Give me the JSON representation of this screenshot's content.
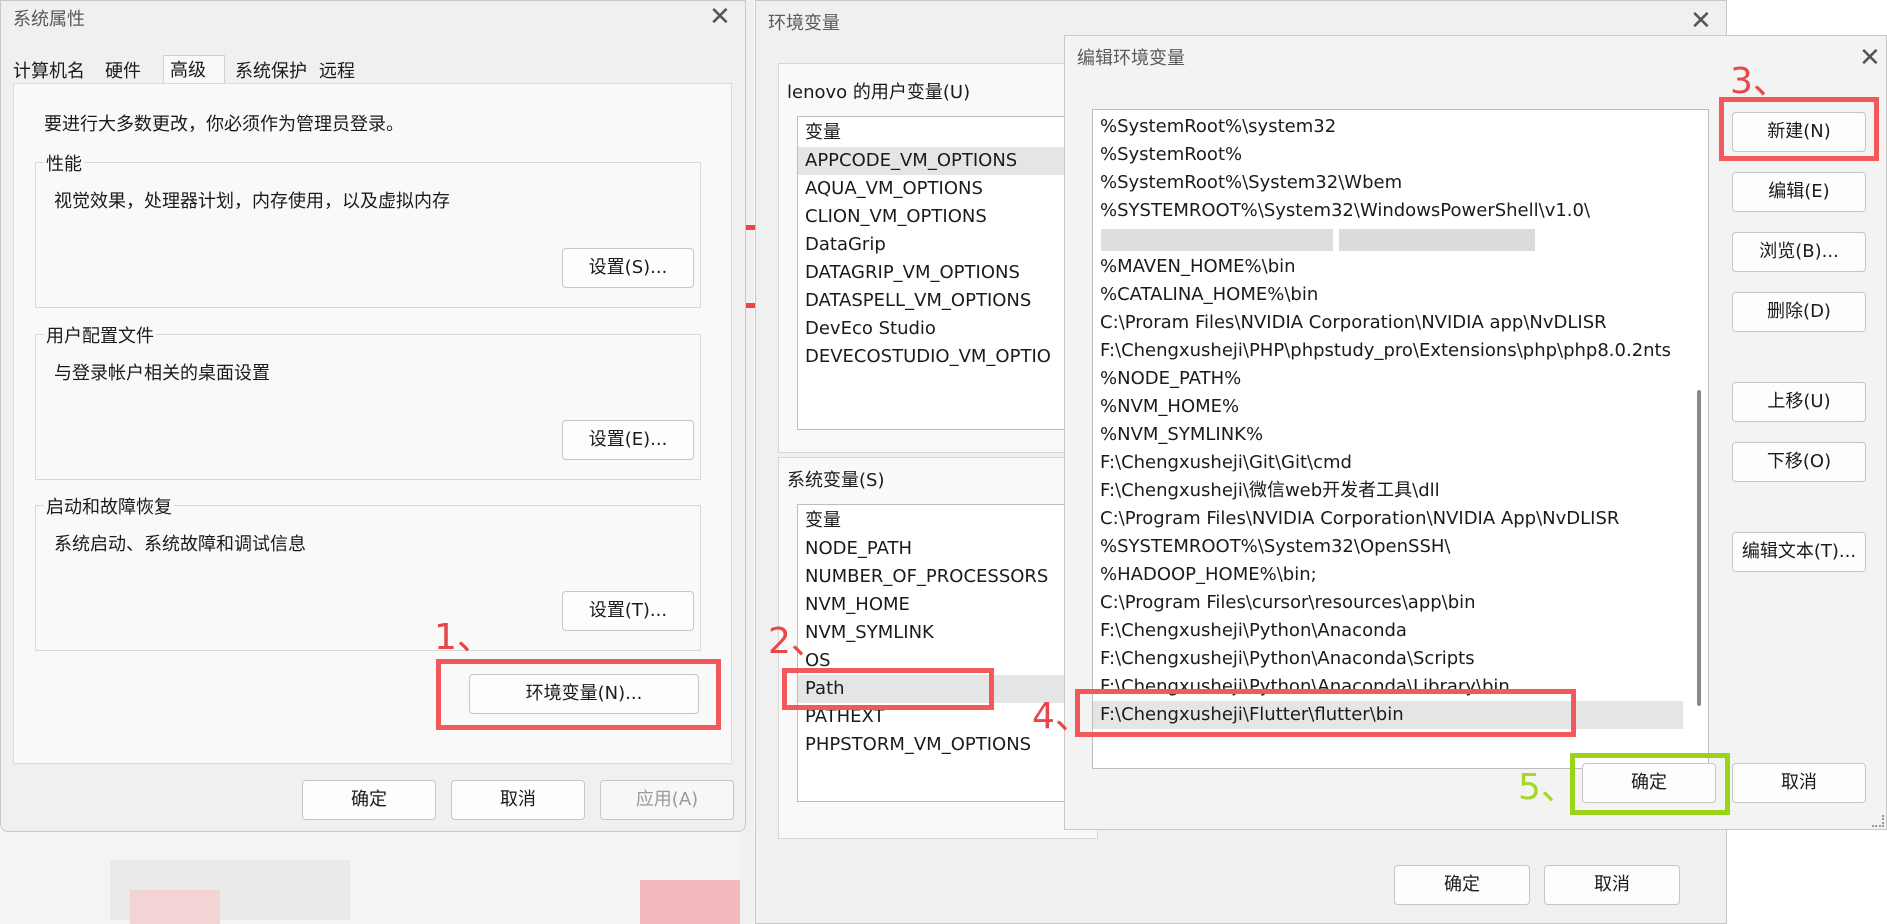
{
  "colors": {
    "red_highlight": "#f2595b",
    "green_highlight": "#9ad317",
    "step_red": "#e8474a",
    "step_green": "#a6d62c"
  },
  "sys_props": {
    "title": "系统属性",
    "tabs": [
      "计算机名",
      "硬件",
      "高级",
      "系统保护",
      "远程"
    ],
    "admin_note": "要进行大多数更改，你必须作为管理员登录。",
    "performance": {
      "label": "性能",
      "desc": "视觉效果，处理器计划，内存使用，以及虚拟内存",
      "button": "设置(S)..."
    },
    "profiles": {
      "label": "用户配置文件",
      "desc": "与登录帐户相关的桌面设置",
      "button": "设置(E)..."
    },
    "startup": {
      "label": "启动和故障恢复",
      "desc": "系统启动、系统故障和调试信息",
      "button": "设置(T)..."
    },
    "env_button": "环境变量(N)...",
    "ok": "确定",
    "cancel": "取消",
    "apply": "应用(A)"
  },
  "env_vars": {
    "title": "环境变量",
    "user_label": "lenovo 的用户变量(U)",
    "user_header": "变量",
    "user_vars": [
      "APPCODE_VM_OPTIONS",
      "AQUA_VM_OPTIONS",
      "CLION_VM_OPTIONS",
      "DataGrip",
      "DATAGRIP_VM_OPTIONS",
      "DATASPELL_VM_OPTIONS",
      "DevEco Studio",
      "DEVECOSTUDIO_VM_OPTIO"
    ],
    "sys_label": "系统变量(S)",
    "sys_header": "变量",
    "sys_vars": [
      "NODE_PATH",
      "NUMBER_OF_PROCESSORS",
      "NVM_HOME",
      "NVM_SYMLINK",
      "OS",
      "Path",
      "PATHEXT",
      "PHPSTORM_VM_OPTIONS"
    ],
    "ok": "确定",
    "cancel": "取消"
  },
  "edit_env": {
    "title": "编辑环境变量",
    "paths": [
      "%SystemRoot%\\system32",
      "%SystemRoot%",
      "%SystemRoot%\\System32\\Wbem",
      "%SYSTEMROOT%\\System32\\WindowsPowerShell\\v1.0\\",
      "",
      "%MAVEN_HOME%\\bin",
      "%CATALINA_HOME%\\bin",
      "C:\\Proram Files\\NVIDIA Corporation\\NVIDIA app\\NvDLISR",
      "F:\\Chengxusheji\\PHP\\phpstudy_pro\\Extensions\\php\\php8.0.2nts",
      "%NODE_PATH%",
      "%NVM_HOME%",
      "%NVM_SYMLINK%",
      "F:\\Chengxusheji\\Git\\Git\\cmd",
      "F:\\Chengxusheji\\微信web开发者工具\\dll",
      "C:\\Program Files\\NVIDIA Corporation\\NVIDIA App\\NvDLISR",
      "%SYSTEMROOT%\\System32\\OpenSSH\\",
      "%HADOOP_HOME%\\bin;",
      "C:\\Program Files\\cursor\\resources\\app\\bin",
      "F:\\Chengxusheji\\Python\\Anaconda",
      "F:\\Chengxusheji\\Python\\Anaconda\\Scripts",
      "F:\\Chengxusheji\\Python\\Anaconda\\Library\\bin",
      "F:\\Chengxusheji\\Flutter\\flutter\\bin"
    ],
    "buttons": {
      "new": "新建(N)",
      "edit": "编辑(E)",
      "browse": "浏览(B)...",
      "delete": "删除(D)",
      "up": "上移(U)",
      "down": "下移(O)",
      "edit_text": "编辑文本(T)..."
    },
    "ok": "确定",
    "cancel": "取消"
  },
  "steps": [
    "1、",
    "2、",
    "3、",
    "4、",
    "5、"
  ]
}
